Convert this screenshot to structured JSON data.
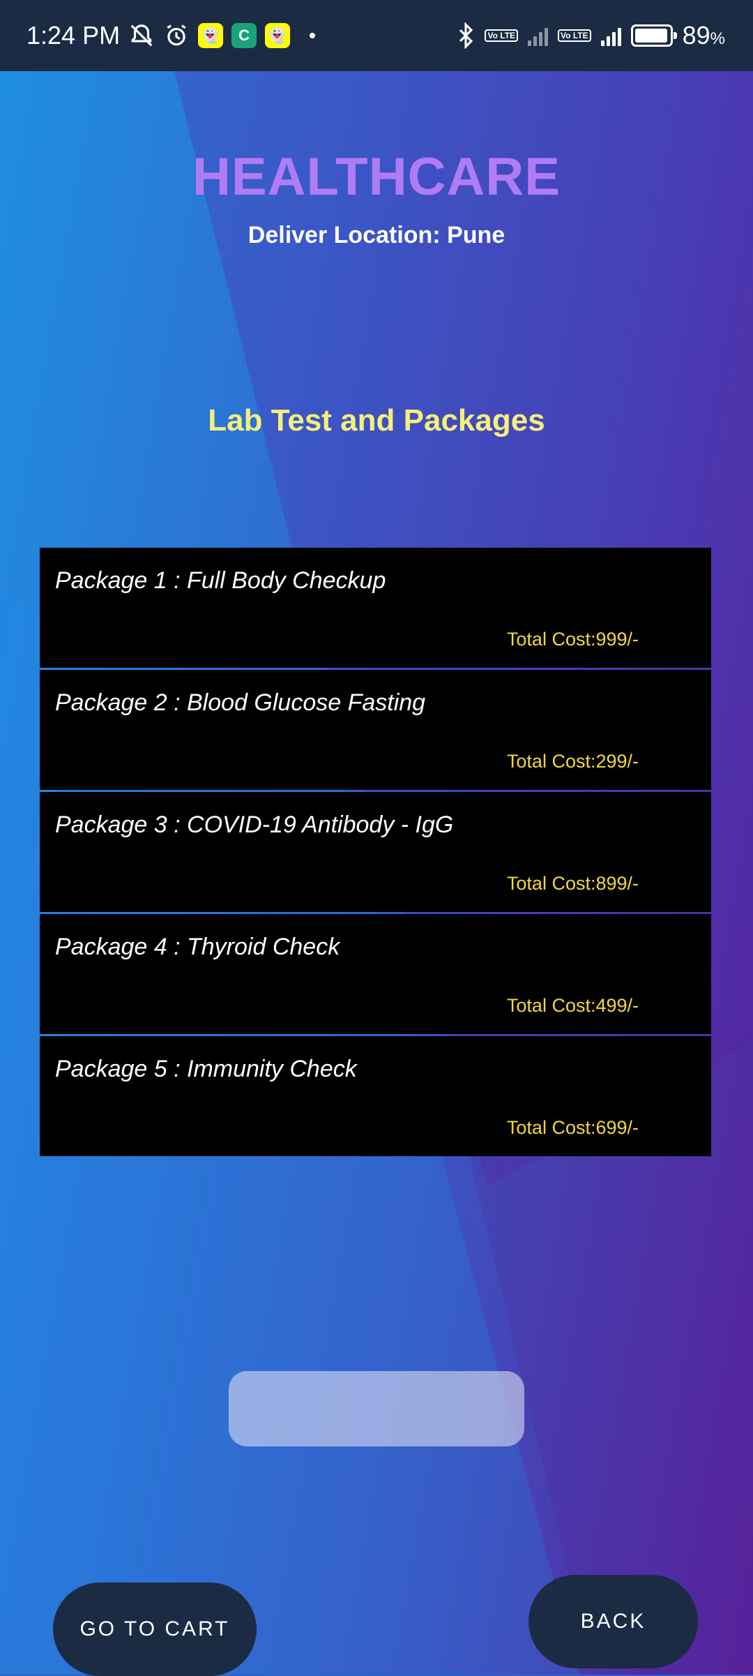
{
  "status_bar": {
    "time": "1:24 PM",
    "battery_percent": "89",
    "battery_unit": "%",
    "volte_label": "Vo LTE",
    "notification_icons": [
      "mute-icon",
      "alarm-icon",
      "snapchat-icon",
      "capcut-icon",
      "snapchat-icon"
    ],
    "right_icons": [
      "bluetooth-icon",
      "volte-icon",
      "signal-icon",
      "volte-icon",
      "signal-icon",
      "battery-icon"
    ]
  },
  "header": {
    "title": "HEALTHCARE",
    "location": "Deliver Location: Pune"
  },
  "section": {
    "title": "Lab Test and Packages"
  },
  "packages": [
    {
      "name": "Package 1 : Full Body Checkup",
      "cost": "Total Cost:999/-"
    },
    {
      "name": "Package 2 : Blood Glucose Fasting",
      "cost": "Total Cost:299/-"
    },
    {
      "name": "Package 3 : COVID-19 Antibody - IgG",
      "cost": "Total Cost:899/-"
    },
    {
      "name": "Package 4 : Thyroid Check",
      "cost": "Total Cost:499/-"
    },
    {
      "name": "Package 5 : Immunity Check",
      "cost": "Total Cost:699/-"
    }
  ],
  "buttons": {
    "cart": "GO TO CART",
    "back": "BACK"
  },
  "colors": {
    "title": "#b07cf5",
    "section_title": "#f7ef7a",
    "cost": "#f4d83c",
    "button_bg": "#1c2b44",
    "status_bg": "#1c2b44"
  }
}
